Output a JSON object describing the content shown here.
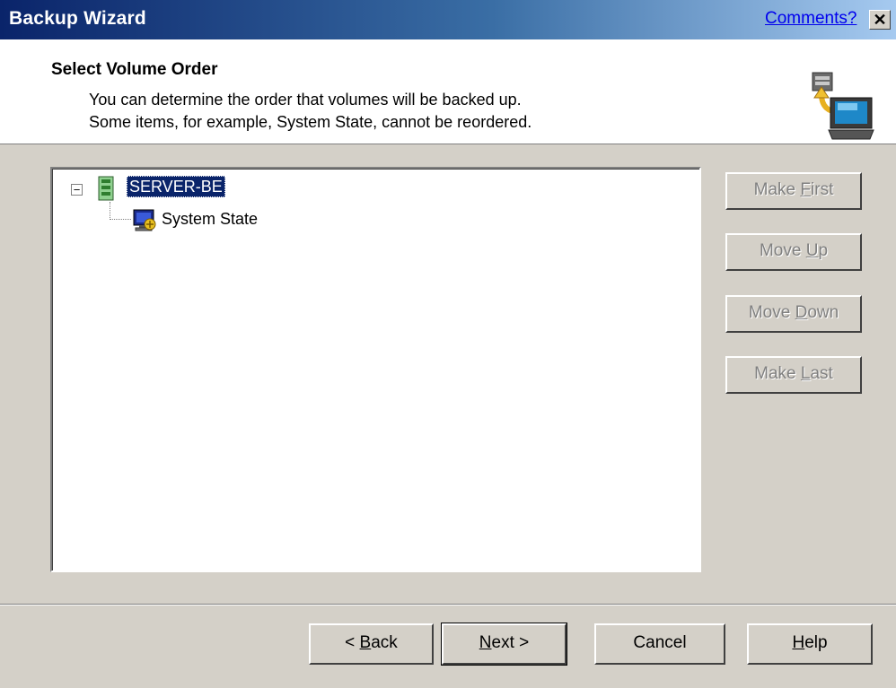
{
  "titlebar": {
    "title": "Backup Wizard",
    "comments_link": "Comments?",
    "close_glyph": "✕"
  },
  "header": {
    "title": "Select Volume Order",
    "desc_line1": "You can determine the order that volumes will be backed up.",
    "desc_line2": "Some items, for example, System State, cannot be reordered.",
    "icon": "backup-computer-icon"
  },
  "tree": {
    "expander": "−",
    "nodes": [
      {
        "label": "SERVER-BE",
        "icon": "server-icon",
        "selected": true
      },
      {
        "label": "System State",
        "icon": "system-state-icon",
        "selected": false
      }
    ]
  },
  "side_buttons": {
    "make_first": {
      "prefix": "Make ",
      "key": "F",
      "rest": "irst"
    },
    "move_up": {
      "prefix": "Move ",
      "key": "U",
      "rest": "p"
    },
    "move_down": {
      "prefix": "Move ",
      "key": "D",
      "rest": "own"
    },
    "make_last": {
      "prefix": "Make ",
      "key": "L",
      "rest": "ast"
    }
  },
  "footer": {
    "back": {
      "prefix": "< ",
      "key": "B",
      "rest": "ack"
    },
    "next": {
      "prefix": "",
      "key": "N",
      "rest": "ext >"
    },
    "cancel": "Cancel",
    "help": {
      "prefix": "",
      "key": "H",
      "rest": "elp"
    }
  },
  "colors": {
    "titlebar_start": "#0a246a",
    "titlebar_end": "#a6caf0",
    "face": "#d4d0c8",
    "selection": "#0a246a"
  }
}
